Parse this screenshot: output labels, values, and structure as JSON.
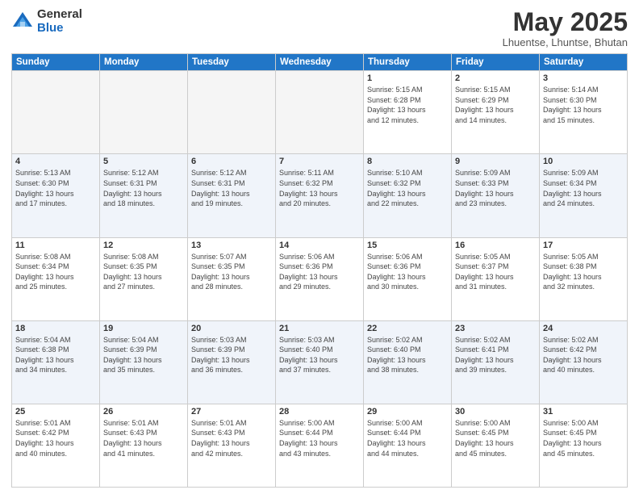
{
  "logo": {
    "general": "General",
    "blue": "Blue"
  },
  "header": {
    "month": "May 2025",
    "location": "Lhuentse, Lhuntse, Bhutan"
  },
  "weekdays": [
    "Sunday",
    "Monday",
    "Tuesday",
    "Wednesday",
    "Thursday",
    "Friday",
    "Saturday"
  ],
  "weeks": [
    [
      {
        "day": "",
        "info": ""
      },
      {
        "day": "",
        "info": ""
      },
      {
        "day": "",
        "info": ""
      },
      {
        "day": "",
        "info": ""
      },
      {
        "day": "1",
        "info": "Sunrise: 5:15 AM\nSunset: 6:28 PM\nDaylight: 13 hours\nand 12 minutes."
      },
      {
        "day": "2",
        "info": "Sunrise: 5:15 AM\nSunset: 6:29 PM\nDaylight: 13 hours\nand 14 minutes."
      },
      {
        "day": "3",
        "info": "Sunrise: 5:14 AM\nSunset: 6:30 PM\nDaylight: 13 hours\nand 15 minutes."
      }
    ],
    [
      {
        "day": "4",
        "info": "Sunrise: 5:13 AM\nSunset: 6:30 PM\nDaylight: 13 hours\nand 17 minutes."
      },
      {
        "day": "5",
        "info": "Sunrise: 5:12 AM\nSunset: 6:31 PM\nDaylight: 13 hours\nand 18 minutes."
      },
      {
        "day": "6",
        "info": "Sunrise: 5:12 AM\nSunset: 6:31 PM\nDaylight: 13 hours\nand 19 minutes."
      },
      {
        "day": "7",
        "info": "Sunrise: 5:11 AM\nSunset: 6:32 PM\nDaylight: 13 hours\nand 20 minutes."
      },
      {
        "day": "8",
        "info": "Sunrise: 5:10 AM\nSunset: 6:32 PM\nDaylight: 13 hours\nand 22 minutes."
      },
      {
        "day": "9",
        "info": "Sunrise: 5:09 AM\nSunset: 6:33 PM\nDaylight: 13 hours\nand 23 minutes."
      },
      {
        "day": "10",
        "info": "Sunrise: 5:09 AM\nSunset: 6:34 PM\nDaylight: 13 hours\nand 24 minutes."
      }
    ],
    [
      {
        "day": "11",
        "info": "Sunrise: 5:08 AM\nSunset: 6:34 PM\nDaylight: 13 hours\nand 25 minutes."
      },
      {
        "day": "12",
        "info": "Sunrise: 5:08 AM\nSunset: 6:35 PM\nDaylight: 13 hours\nand 27 minutes."
      },
      {
        "day": "13",
        "info": "Sunrise: 5:07 AM\nSunset: 6:35 PM\nDaylight: 13 hours\nand 28 minutes."
      },
      {
        "day": "14",
        "info": "Sunrise: 5:06 AM\nSunset: 6:36 PM\nDaylight: 13 hours\nand 29 minutes."
      },
      {
        "day": "15",
        "info": "Sunrise: 5:06 AM\nSunset: 6:36 PM\nDaylight: 13 hours\nand 30 minutes."
      },
      {
        "day": "16",
        "info": "Sunrise: 5:05 AM\nSunset: 6:37 PM\nDaylight: 13 hours\nand 31 minutes."
      },
      {
        "day": "17",
        "info": "Sunrise: 5:05 AM\nSunset: 6:38 PM\nDaylight: 13 hours\nand 32 minutes."
      }
    ],
    [
      {
        "day": "18",
        "info": "Sunrise: 5:04 AM\nSunset: 6:38 PM\nDaylight: 13 hours\nand 34 minutes."
      },
      {
        "day": "19",
        "info": "Sunrise: 5:04 AM\nSunset: 6:39 PM\nDaylight: 13 hours\nand 35 minutes."
      },
      {
        "day": "20",
        "info": "Sunrise: 5:03 AM\nSunset: 6:39 PM\nDaylight: 13 hours\nand 36 minutes."
      },
      {
        "day": "21",
        "info": "Sunrise: 5:03 AM\nSunset: 6:40 PM\nDaylight: 13 hours\nand 37 minutes."
      },
      {
        "day": "22",
        "info": "Sunrise: 5:02 AM\nSunset: 6:40 PM\nDaylight: 13 hours\nand 38 minutes."
      },
      {
        "day": "23",
        "info": "Sunrise: 5:02 AM\nSunset: 6:41 PM\nDaylight: 13 hours\nand 39 minutes."
      },
      {
        "day": "24",
        "info": "Sunrise: 5:02 AM\nSunset: 6:42 PM\nDaylight: 13 hours\nand 40 minutes."
      }
    ],
    [
      {
        "day": "25",
        "info": "Sunrise: 5:01 AM\nSunset: 6:42 PM\nDaylight: 13 hours\nand 40 minutes."
      },
      {
        "day": "26",
        "info": "Sunrise: 5:01 AM\nSunset: 6:43 PM\nDaylight: 13 hours\nand 41 minutes."
      },
      {
        "day": "27",
        "info": "Sunrise: 5:01 AM\nSunset: 6:43 PM\nDaylight: 13 hours\nand 42 minutes."
      },
      {
        "day": "28",
        "info": "Sunrise: 5:00 AM\nSunset: 6:44 PM\nDaylight: 13 hours\nand 43 minutes."
      },
      {
        "day": "29",
        "info": "Sunrise: 5:00 AM\nSunset: 6:44 PM\nDaylight: 13 hours\nand 44 minutes."
      },
      {
        "day": "30",
        "info": "Sunrise: 5:00 AM\nSunset: 6:45 PM\nDaylight: 13 hours\nand 45 minutes."
      },
      {
        "day": "31",
        "info": "Sunrise: 5:00 AM\nSunset: 6:45 PM\nDaylight: 13 hours\nand 45 minutes."
      }
    ]
  ]
}
